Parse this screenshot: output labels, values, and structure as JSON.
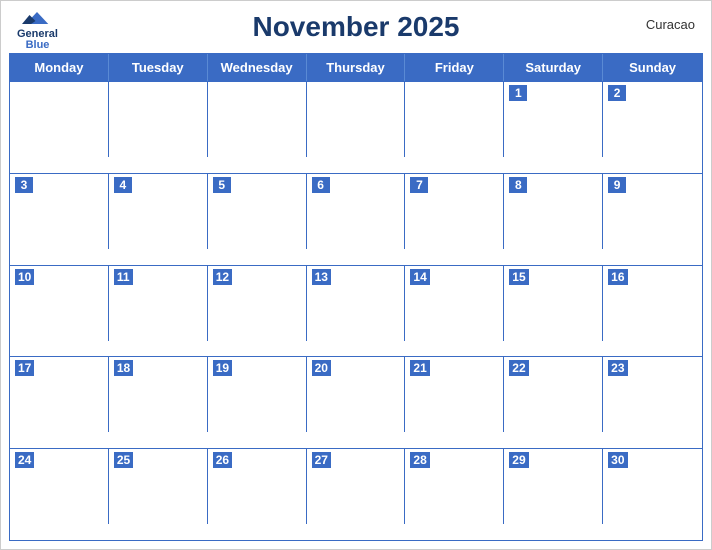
{
  "calendar": {
    "title": "November 2025",
    "region": "Curacao",
    "logo": {
      "line1": "General",
      "line2": "Blue"
    },
    "dayHeaders": [
      "Monday",
      "Tuesday",
      "Wednesday",
      "Thursday",
      "Friday",
      "Saturday",
      "Sunday"
    ],
    "weeks": [
      [
        {
          "date": "",
          "empty": true
        },
        {
          "date": "",
          "empty": true
        },
        {
          "date": "",
          "empty": true
        },
        {
          "date": "",
          "empty": true
        },
        {
          "date": "",
          "empty": true
        },
        {
          "date": "1"
        },
        {
          "date": "2"
        }
      ],
      [
        {
          "date": "3"
        },
        {
          "date": "4"
        },
        {
          "date": "5"
        },
        {
          "date": "6"
        },
        {
          "date": "7"
        },
        {
          "date": "8"
        },
        {
          "date": "9"
        }
      ],
      [
        {
          "date": "10"
        },
        {
          "date": "11"
        },
        {
          "date": "12"
        },
        {
          "date": "13"
        },
        {
          "date": "14"
        },
        {
          "date": "15"
        },
        {
          "date": "16"
        }
      ],
      [
        {
          "date": "17"
        },
        {
          "date": "18"
        },
        {
          "date": "19"
        },
        {
          "date": "20"
        },
        {
          "date": "21"
        },
        {
          "date": "22"
        },
        {
          "date": "23"
        }
      ],
      [
        {
          "date": "24"
        },
        {
          "date": "25"
        },
        {
          "date": "26"
        },
        {
          "date": "27"
        },
        {
          "date": "28"
        },
        {
          "date": "29"
        },
        {
          "date": "30"
        }
      ]
    ]
  },
  "colors": {
    "headerBg": "#3a6bc4",
    "titleColor": "#1a3a6b",
    "borderColor": "#3a6bc4"
  }
}
